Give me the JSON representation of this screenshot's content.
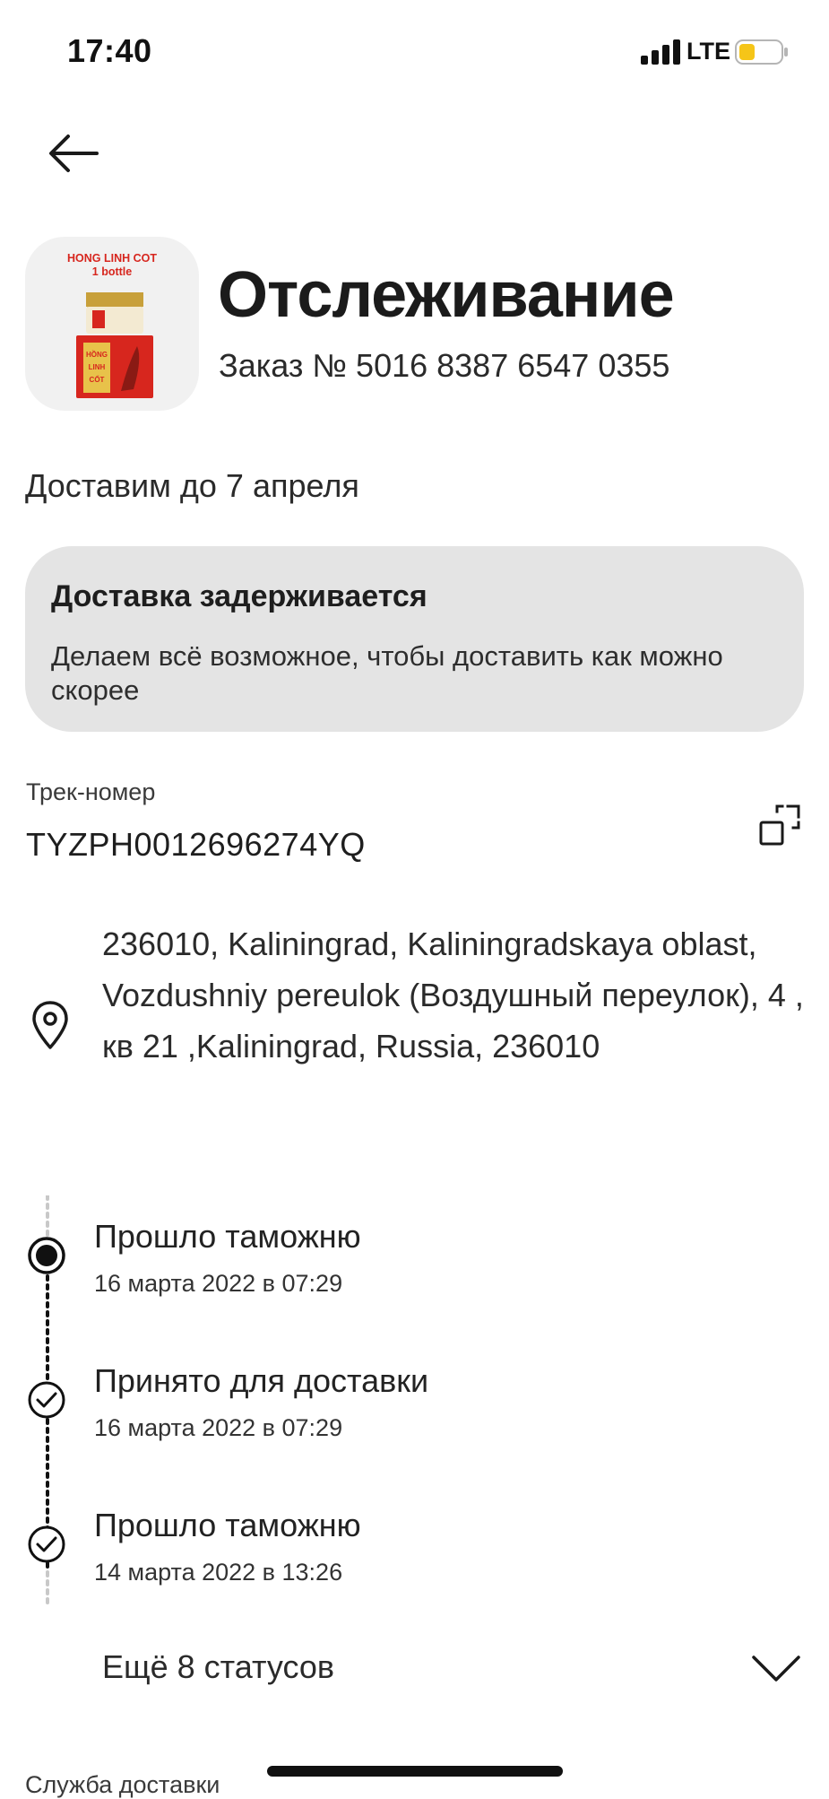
{
  "status_bar": {
    "time": "17:40",
    "network": "LTE",
    "battery_color": "#f5c518"
  },
  "product": {
    "brand": "HONG LINH COT",
    "variant": "1 bottle",
    "jar_text": "HỒNG LINH CỐT",
    "accent": "#d7261e"
  },
  "header": {
    "title": "Отслеживание",
    "order": "Заказ № 5016 8387 6547 0355"
  },
  "delivery": {
    "estimate": "Доставим до 7 апреля"
  },
  "notice": {
    "title": "Доставка задерживается",
    "text": "Делаем всё возможное, чтобы доставить как можно скорее"
  },
  "tracking": {
    "label": "Трек-номер",
    "number": "TYZPH0012696274YQ"
  },
  "address": {
    "text": "236010, Kaliningrad, Kaliningradskaya oblast, Vozdushniy pereulok (Воздушный переулок), 4 , кв 21 ,Kaliningrad, Russia, 236010"
  },
  "timeline": [
    {
      "title": "Прошло таможню",
      "date": "16 марта 2022 в 07:29",
      "icon": "current-dot-icon"
    },
    {
      "title": "Принято для доставки",
      "date": "16 марта 2022 в 07:29",
      "icon": "check-circle-icon"
    },
    {
      "title": "Прошло таможню",
      "date": "14 марта 2022 в 13:26",
      "icon": "check-circle-icon"
    }
  ],
  "more": {
    "label": "Ещё 8 статусов"
  },
  "footer": {
    "service_label": "Служба доставки"
  }
}
